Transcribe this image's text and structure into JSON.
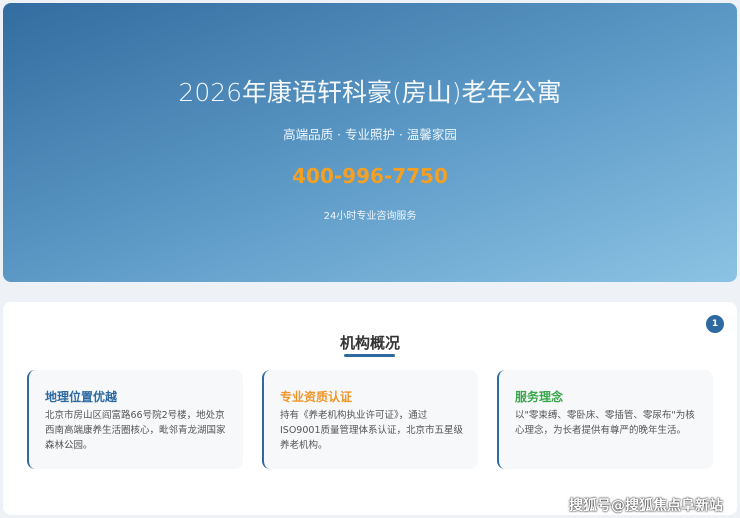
{
  "hero": {
    "title": "2026年康语轩科豪(房山)老年公寓",
    "subtitle": "高端品质 · 专业照护 · 温馨家园",
    "phone": "400-996-7750",
    "note": "24小时专业咨询服务"
  },
  "overview": {
    "title": "机构概况",
    "badge": "1",
    "cards": [
      {
        "title": "地理位置优越",
        "color": "#2e6aa0",
        "text": "北京市房山区阎富路66号院2号楼，地处京西南高端康养生活圈核心，毗邻青龙湖国家森林公园。"
      },
      {
        "title": "专业资质认证",
        "color": "#f0962a",
        "text": "持有《养老机构执业许可证》，通过ISO9001质量管理体系认证，北京市五星级养老机构。"
      },
      {
        "title": "服务理念",
        "color": "#3aa64a",
        "text": "以\"零束缚、零卧床、零插管、零尿布\"为核心理念，为长者提供有尊严的晚年生活。"
      }
    ]
  },
  "watermark": "搜狐号@搜狐焦点阜新站"
}
